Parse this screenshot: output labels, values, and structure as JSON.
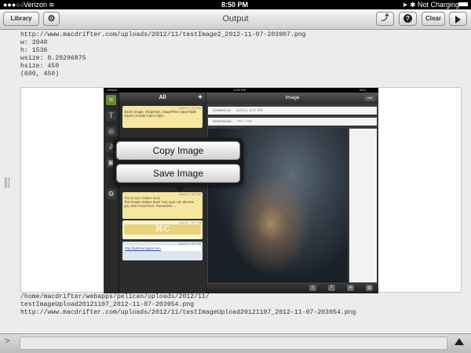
{
  "status_bar": {
    "carrier": "Verizon",
    "time": "8:50 PM",
    "battery_status": "Not Charging"
  },
  "toolbar": {
    "title": "Output",
    "library_label": "Library",
    "clear_label": "Clear",
    "icons": [
      "gear-icon",
      "share-icon",
      "help-icon",
      "play-icon"
    ]
  },
  "output": {
    "text_lines": [
      "http://www.macdrifter.com/uploads/2012/11/testImage2_2012-11-07-203907.png",
      "w: 2048",
      "h: 1536",
      "wsize: 0.29296875",
      "hsize: 450",
      "(600, 450)"
    ],
    "bottom_lines": [
      "/home/macdrifter/webapps/pelican/uploads/2012/11/",
      "testImageUpload20121107_2012-11-07-203954.png",
      "http://www.macdrifter.com/uploads/2012/11/testImageUpload20121107_2012-11-07-203954.png"
    ]
  },
  "screenshot": {
    "status": {
      "carrier": "Verizon",
      "time": "8:59 PM",
      "battery": "61%"
    },
    "list_title": "All",
    "plus": "+",
    "notes": [
      {
        "date": "11/6/12, 7:57 PM",
        "text": "import Image, ImageOps, ImageFilter import ftplib import console import clipb..."
      },
      {
        "date": "11/6/12, 7:57 PM",
        "title": "The Empire Strikes Back",
        "text": "The Empire Strikes Back Your eyes can deceive you. Don't trust them. Remember...."
      },
      {
        "date": "11/6/12, 7:37 PM",
        "text": "⌘C"
      },
      {
        "date": "11/6/12, 7:37 PM",
        "text": "http://lightroomapps.com"
      }
    ],
    "detail_title": "Image",
    "edit_label": "Edit",
    "created_label": "Created on:",
    "created_value": "11/6/12, 8:07 PM",
    "dimensions_label": "Dimensions:",
    "dimensions_value": "707 x 761",
    "popover": {
      "copy_label": "Copy Image",
      "save_label": "Save Image"
    }
  },
  "input_bar": {
    "prompt": ">",
    "value": ""
  }
}
